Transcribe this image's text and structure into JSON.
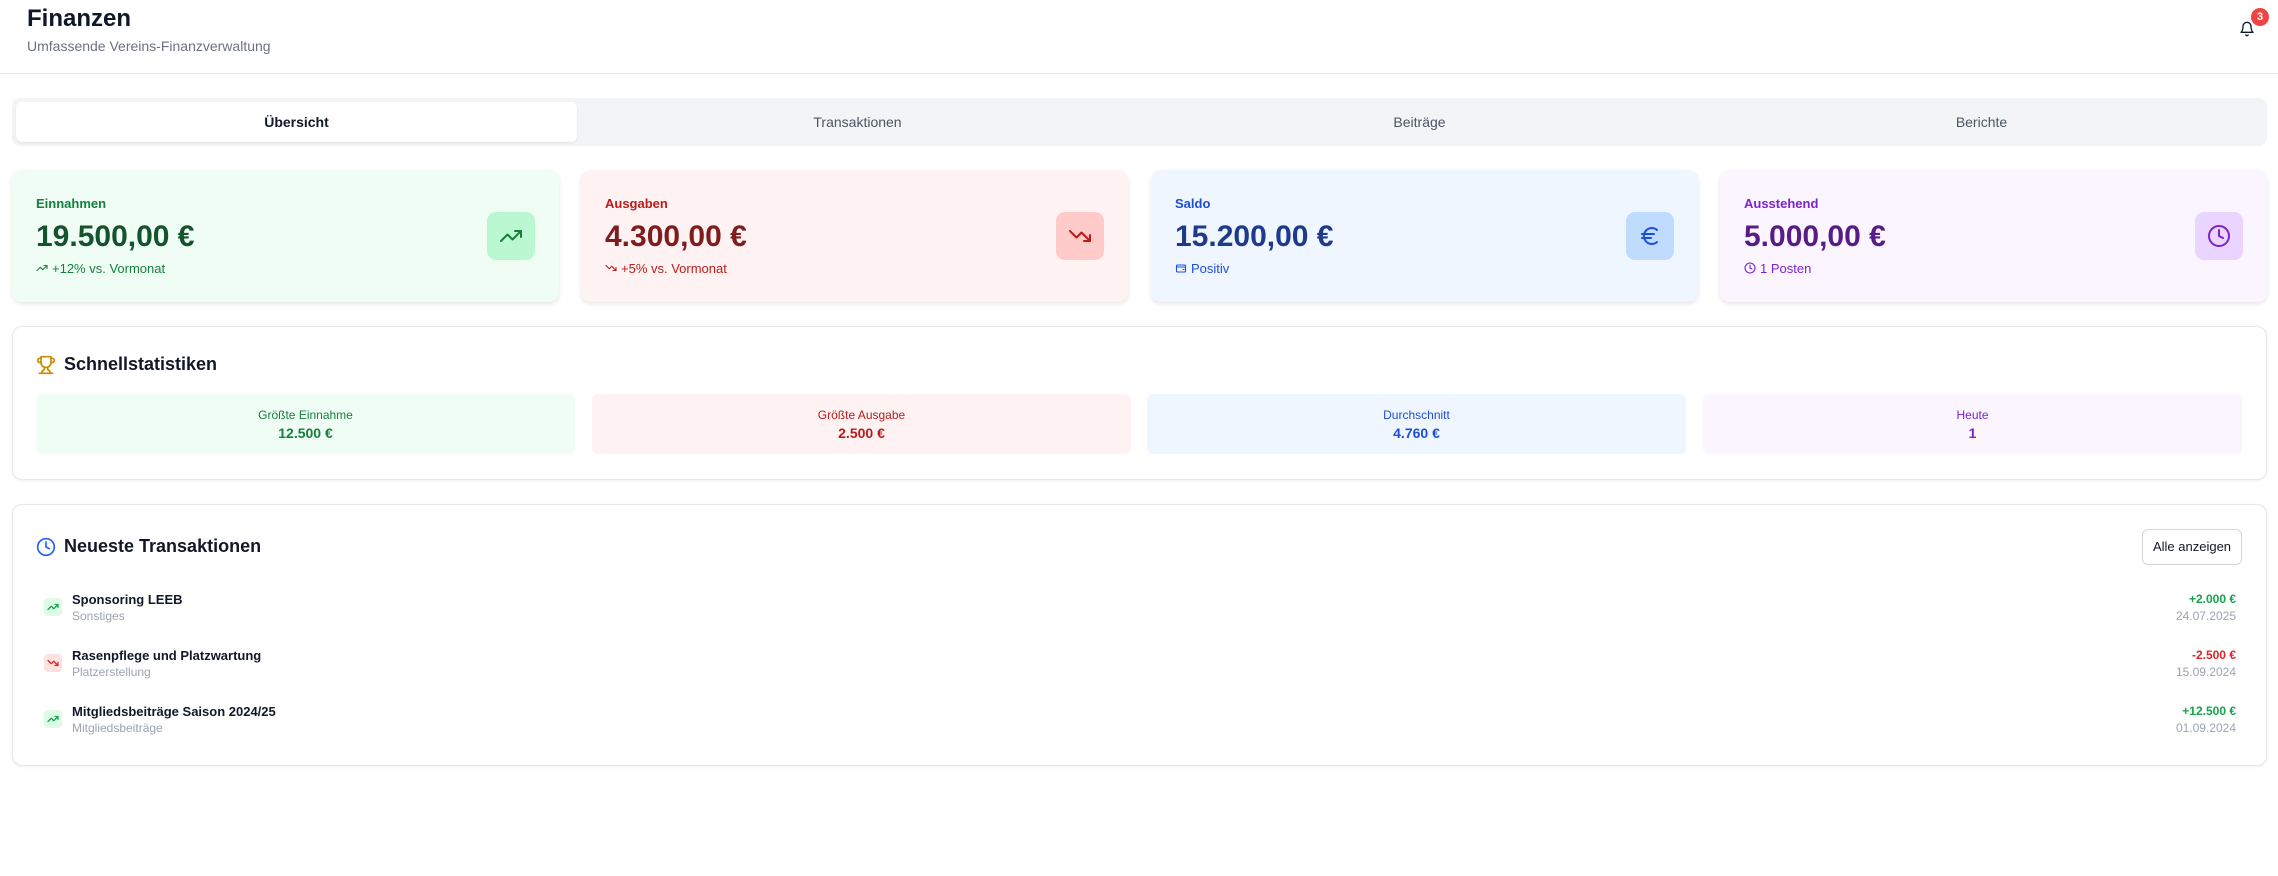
{
  "header": {
    "title": "Finanzen",
    "subtitle": "Umfassende Vereins-Finanzverwaltung",
    "notification_count": "3"
  },
  "tabs": [
    {
      "label": "Übersicht",
      "active": true
    },
    {
      "label": "Transaktionen",
      "active": false
    },
    {
      "label": "Beiträge",
      "active": false
    },
    {
      "label": "Berichte",
      "active": false
    }
  ],
  "stats": [
    {
      "label": "Einnahmen",
      "value": "19.500,00 €",
      "sub": "+12% vs. Vormonat",
      "icon": "trending-up-icon",
      "color": "#15803d",
      "bg": "#f0fdf4",
      "icon_bg": "#bbf7d0",
      "value_color": "#14532d"
    },
    {
      "label": "Ausgaben",
      "value": "4.300,00 €",
      "sub": "+5% vs. Vormonat",
      "icon": "trending-down-icon",
      "color": "#b91c1c",
      "bg": "#fef2f2",
      "icon_bg": "#fecaca",
      "value_color": "#7f1d1d"
    },
    {
      "label": "Saldo",
      "value": "15.200,00 €",
      "sub": "Positiv",
      "icon": "euro-icon",
      "color": "#1d4ed8",
      "bg": "#eff6ff",
      "icon_bg": "#bfdbfe",
      "value_color": "#1e3a8a"
    },
    {
      "label": "Ausstehend",
      "value": "5.000,00 €",
      "sub": "1 Posten",
      "icon": "clock-icon",
      "color": "#7e22ce",
      "bg": "#faf5ff",
      "icon_bg": "#e9d5ff",
      "value_color": "#581c87"
    }
  ],
  "quick_stats": {
    "title": "Schnellstatistiken",
    "items": [
      {
        "label": "Größte Einnahme",
        "value": "12.500 €",
        "color": "#15803d",
        "bg": "#f0fdf4"
      },
      {
        "label": "Größte Ausgabe",
        "value": "2.500 €",
        "color": "#b91c1c",
        "bg": "#fef2f2"
      },
      {
        "label": "Durchschnitt",
        "value": "4.760 €",
        "color": "#1d4ed8",
        "bg": "#eff6ff"
      },
      {
        "label": "Heute",
        "value": "1",
        "color": "#7e22ce",
        "bg": "#faf5ff"
      }
    ]
  },
  "recent": {
    "title": "Neueste Transaktionen",
    "show_all_label": "Alle anzeigen",
    "items": [
      {
        "title": "Sponsoring LEEB",
        "category": "Sonstiges",
        "amount": "+2.000 €",
        "date": "24.07.2025",
        "type": "income"
      },
      {
        "title": "Rasenpflege und Platzwartung",
        "category": "Platzerstellung",
        "amount": "-2.500 €",
        "date": "15.09.2024",
        "type": "expense"
      },
      {
        "title": "Mitgliedsbeiträge Saison 2024/25",
        "category": "Mitgliedsbeiträge",
        "amount": "+12.500 €",
        "date": "01.09.2024",
        "type": "income"
      }
    ]
  },
  "colors": {
    "income": "#16a34a",
    "expense": "#dc2626",
    "trophy": "#ca8a04",
    "clock_blue": "#2563eb"
  }
}
